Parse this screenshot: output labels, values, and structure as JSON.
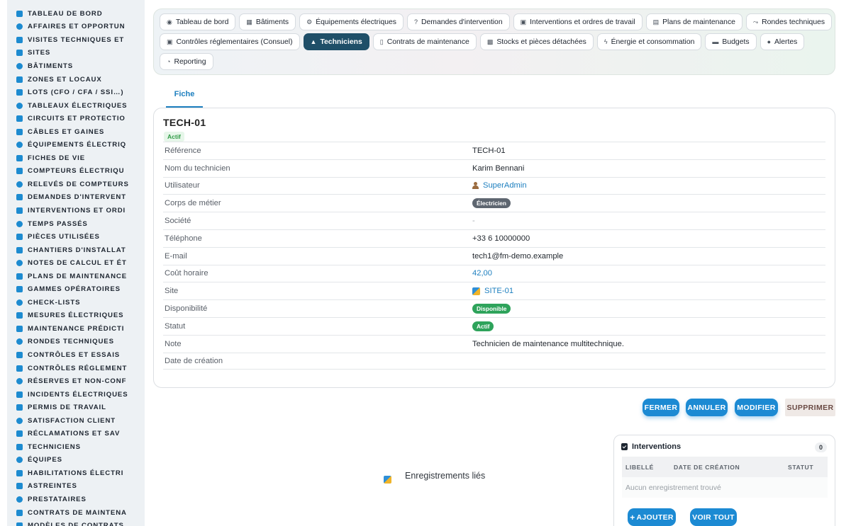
{
  "sidebar": {
    "items": [
      {
        "label": "TABLEAU DE BORD",
        "icon": "dashboard-icon"
      },
      {
        "label": "AFFAIRES ET OPPORTUN",
        "icon": "target-icon"
      },
      {
        "label": "VISITES TECHNIQUES ET",
        "icon": "clipboard-icon"
      },
      {
        "label": "SITES",
        "icon": "location-pin-icon"
      },
      {
        "label": "BÂTIMENTS",
        "icon": "building-icon"
      },
      {
        "label": "ZONES ET LOCAUX",
        "icon": "door-icon"
      },
      {
        "label": "LOTS (CFO / CFA / SSI…)",
        "icon": "sitemap-icon"
      },
      {
        "label": "TABLEAUX ÉLECTRIQUES",
        "icon": "grid-icon"
      },
      {
        "label": "CIRCUITS ET PROTECTIO",
        "icon": "circuit-icon"
      },
      {
        "label": "CÂBLES ET GAINES",
        "icon": "cable-icon"
      },
      {
        "label": "ÉQUIPEMENTS ÉLECTRIQ",
        "icon": "gears-icon"
      },
      {
        "label": "FICHES DE VIE",
        "icon": "history-icon"
      },
      {
        "label": "COMPTEURS ÉLECTRIQU",
        "icon": "gauge-icon"
      },
      {
        "label": "RELEVÉS DE COMPTEURS",
        "icon": "reading-icon"
      },
      {
        "label": "DEMANDES D'INTERVENT",
        "icon": "question-icon"
      },
      {
        "label": "INTERVENTIONS ET ORDI",
        "icon": "clipboard-check-icon"
      },
      {
        "label": "TEMPS PASSÉS",
        "icon": "clock-icon"
      },
      {
        "label": "PIÈCES UTILISÉES",
        "icon": "box-icon"
      },
      {
        "label": "CHANTIERS D'INSTALLAT",
        "icon": "hammer-icon"
      },
      {
        "label": "NOTES DE CALCUL ET ÉT",
        "icon": "calculator-icon"
      },
      {
        "label": "PLANS DE MAINTENANCE",
        "icon": "calendar-icon"
      },
      {
        "label": "GAMMES OPÉRATOIRES",
        "icon": "list-icon"
      },
      {
        "label": "CHECK-LISTS",
        "icon": "checklist-icon"
      },
      {
        "label": "MESURES ÉLECTRIQUES",
        "icon": "thermometer-icon"
      },
      {
        "label": "MAINTENANCE PRÉDICTI",
        "icon": "chart-line-icon"
      },
      {
        "label": "RONDES TECHNIQUES",
        "icon": "route-icon"
      },
      {
        "label": "CONTRÔLES ET ESSAIS",
        "icon": "search-icon"
      },
      {
        "label": "CONTRÔLES RÉGLEMENT",
        "icon": "clipboard-list-icon"
      },
      {
        "label": "RÉSERVES ET NON-CONF",
        "icon": "alert-circle-icon"
      },
      {
        "label": "INCIDENTS ÉLECTRIQUES",
        "icon": "warning-icon"
      },
      {
        "label": "PERMIS DE TRAVAIL",
        "icon": "file-signature-icon"
      },
      {
        "label": "SATISFACTION CLIENT",
        "icon": "smile-icon"
      },
      {
        "label": "RÉCLAMATIONS ET SAV",
        "icon": "comment-icon"
      },
      {
        "label": "TECHNICIENS",
        "icon": "hard-hat-icon"
      },
      {
        "label": "ÉQUIPES",
        "icon": "users-icon"
      },
      {
        "label": "HABILITATIONS ÉLECTRI",
        "icon": "badge-icon"
      },
      {
        "label": "ASTREINTES",
        "icon": "phone-icon"
      },
      {
        "label": "PRESTATAIRES",
        "icon": "handshake-icon"
      },
      {
        "label": "CONTRATS DE MAINTENA",
        "icon": "file-contract-icon"
      },
      {
        "label": "MODÈLES DE CONTRATS",
        "icon": "file-icon"
      }
    ]
  },
  "topnav": {
    "row1": [
      {
        "label": "Tableau de bord",
        "icon": "dashboard-icon",
        "active": false
      },
      {
        "label": "Bâtiments",
        "icon": "building-icon",
        "active": false
      },
      {
        "label": "Équipements électriques",
        "icon": "gears-icon",
        "active": false
      },
      {
        "label": "Demandes d'intervention",
        "icon": "question-icon",
        "active": false
      },
      {
        "label": "Interventions et ordres de travail",
        "icon": "clipboard-check-icon",
        "active": false
      },
      {
        "label": "Plans de maintenance",
        "icon": "calendar-icon",
        "active": false
      },
      {
        "label": "Rondes techniques",
        "icon": "route-icon",
        "active": false
      }
    ],
    "row2": [
      {
        "label": "Contrôles réglementaires (Consuel)",
        "icon": "clipboard-list-icon",
        "active": false
      },
      {
        "label": "Techniciens",
        "icon": "hard-hat-icon",
        "active": true
      },
      {
        "label": "Contrats de maintenance",
        "icon": "file-contract-icon",
        "active": false
      },
      {
        "label": "Stocks et pièces détachées",
        "icon": "boxes-icon",
        "active": false
      },
      {
        "label": "Énergie et consommation",
        "icon": "bolt-icon",
        "active": false
      },
      {
        "label": "Budgets",
        "icon": "money-icon",
        "active": false
      },
      {
        "label": "Alertes",
        "icon": "bell-icon",
        "active": false
      }
    ],
    "row3": [
      {
        "label": "Reporting",
        "icon": "chart-pie-icon",
        "active": false
      }
    ]
  },
  "tabs": {
    "fiche": "Fiche"
  },
  "record": {
    "title": "TECH-01",
    "status_badge": "Actif",
    "fields": [
      {
        "label": "Référence",
        "value": "TECH-01",
        "kind": "text"
      },
      {
        "label": "Nom du technicien",
        "value": "Karim Bennani",
        "kind": "text"
      },
      {
        "label": "Utilisateur",
        "value": "SuperAdmin",
        "kind": "user-link"
      },
      {
        "label": "Corps de métier",
        "value": "Électricien",
        "kind": "pill-grey"
      },
      {
        "label": "Société",
        "value": "-",
        "kind": "muted"
      },
      {
        "label": "Téléphone",
        "value": "+33 6 10000000",
        "kind": "text"
      },
      {
        "label": "E-mail",
        "value": "tech1@fm-demo.example",
        "kind": "text"
      },
      {
        "label": "Coût horaire",
        "value": "42,00",
        "kind": "link"
      },
      {
        "label": "Site",
        "value": "SITE-01",
        "kind": "site-link"
      },
      {
        "label": "Disponibilité",
        "value": "Disponible",
        "kind": "pill-green"
      },
      {
        "label": "Statut",
        "value": "Actif",
        "kind": "pill-green"
      },
      {
        "label": "Note",
        "value": "Technicien de maintenance multitechnique.",
        "kind": "text"
      },
      {
        "label": "Date de création",
        "value": "",
        "kind": "text"
      }
    ]
  },
  "actions": {
    "close": "FERMER",
    "cancel": "ANNULER",
    "edit": "MODIFIER",
    "delete": "SUPPRIMER"
  },
  "linked": {
    "title": "Enregistrements liés"
  },
  "interventions": {
    "title": "Interventions",
    "count": "0",
    "columns": [
      "LIBELLÉ",
      "DATE DE CRÉATION",
      "STATUT"
    ],
    "empty_text": "Aucun enregistrement trouvé",
    "add_label": "AJOUTER",
    "view_all_label": "VOIR TOUT"
  },
  "colors": {
    "accent": "#1c8ad3",
    "active_nav": "#1f4f68",
    "success": "#2ea35b",
    "sidebar_bg": "#edf1f4"
  }
}
